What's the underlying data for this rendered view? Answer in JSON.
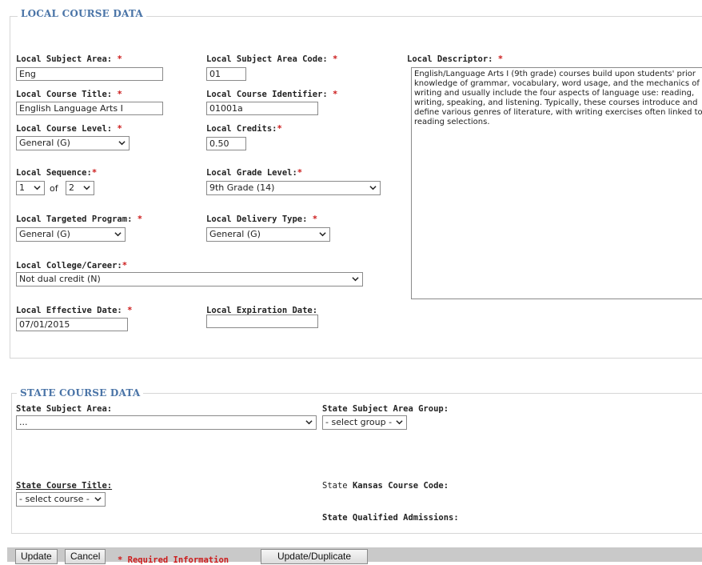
{
  "local": {
    "legend": "LOCAL COURSE DATA",
    "subject_area": {
      "label": "Local Subject Area:",
      "value": "Eng"
    },
    "subject_area_code": {
      "label": "Local Subject Area Code:",
      "value": "01"
    },
    "descriptor": {
      "label": "Local Descriptor:",
      "value": "English/Language Arts I (9th grade) courses build upon students' prior knowledge of grammar, vocabulary, word usage, and the mechanics of writing and usually include the four aspects of language use: reading, writing, speaking, and listening. Typically, these courses introduce and define various genres of literature, with writing exercises often linked to reading selections."
    },
    "course_title": {
      "label": "Local Course Title:",
      "value": "English Language Arts I"
    },
    "course_identifier": {
      "label": "Local Course Identifier:",
      "value": "01001a"
    },
    "course_level": {
      "label": "Local Course Level:",
      "value": "General (G)"
    },
    "credits": {
      "label": "Local Credits:",
      "value": "0.50"
    },
    "sequence": {
      "label": "Local Sequence:",
      "value": "1",
      "of_label": "of",
      "of_value": "2"
    },
    "grade_level": {
      "label": "Local Grade Level:",
      "value": "9th Grade (14)"
    },
    "targeted_program": {
      "label": "Local Targeted Program:",
      "value": "General (G)"
    },
    "delivery_type": {
      "label": "Local Delivery Type:",
      "value": "General (G)"
    },
    "college_career": {
      "label": "Local College/Career:",
      "value": "Not dual credit (N)"
    },
    "effective_date": {
      "label": "Local Effective Date:",
      "value": "07/01/2015"
    },
    "expiration_date": {
      "label": "Local Expiration Date:",
      "value": ""
    },
    "required_mark": "*"
  },
  "state": {
    "legend": "STATE COURSE DATA",
    "subject_area": {
      "label": "State Subject Area:",
      "value": "..."
    },
    "subject_area_group": {
      "label": "State Subject Area Group:",
      "value": "- select group -"
    },
    "course_title": {
      "label": "State Course Title:",
      "value": "- select course -"
    },
    "kansas_course_code": {
      "label_prefix": "State",
      "label_rest": "Kansas Course Code:"
    },
    "qualified_admissions": {
      "label": "State Qualified Admissions:"
    }
  },
  "toolbar": {
    "update": "Update",
    "cancel": "Cancel",
    "required_info_mark": "*",
    "required_info": "Required Information",
    "update_duplicate": "Update/Duplicate"
  },
  "colors": {
    "legend": "#4a74a7",
    "required": "#cc1b1b",
    "toolbar": "#c9c9c9"
  },
  "icons": {
    "dropdown": "chevron-down-icon"
  }
}
